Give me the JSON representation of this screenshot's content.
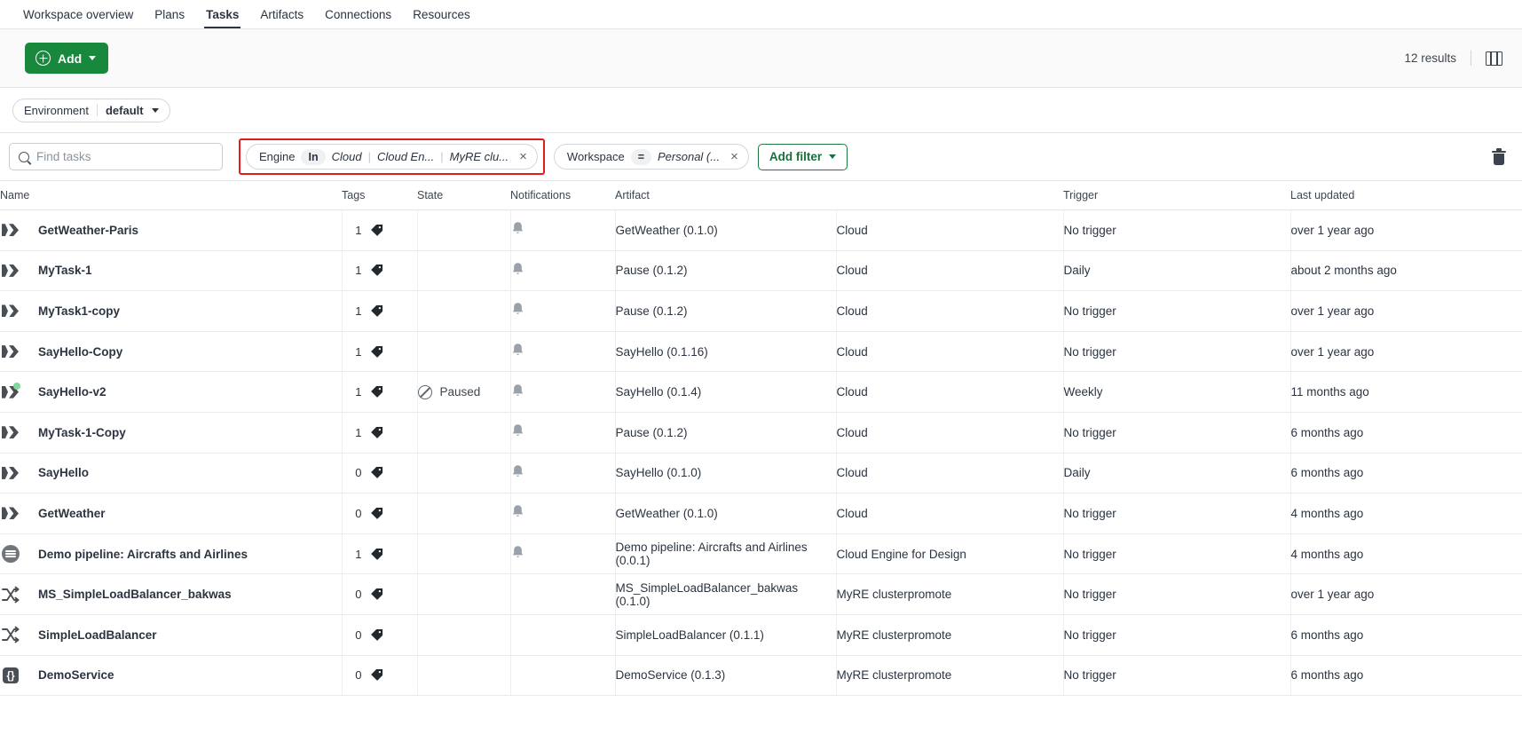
{
  "topnav": {
    "items": [
      {
        "label": "Workspace overview",
        "active": false
      },
      {
        "label": "Plans",
        "active": false
      },
      {
        "label": "Tasks",
        "active": true
      },
      {
        "label": "Artifacts",
        "active": false
      },
      {
        "label": "Connections",
        "active": false
      },
      {
        "label": "Resources",
        "active": false
      }
    ]
  },
  "actionbar": {
    "add_label": "Add",
    "results_label": "12 results",
    "columns_icon": "columns-icon"
  },
  "environment": {
    "label": "Environment",
    "value": "default"
  },
  "search": {
    "placeholder": "Find tasks",
    "value": "",
    "icon": "search-icon"
  },
  "filters": {
    "engine": {
      "key": "Engine",
      "operator": "In",
      "values": [
        "Cloud",
        "Cloud En...",
        "MyRE clu..."
      ],
      "remove_label": "×",
      "highlighted": true
    },
    "workspace": {
      "key": "Workspace",
      "operator": "=",
      "values": [
        "Personal (..."
      ],
      "remove_label": "×"
    },
    "add_filter_label": "Add filter",
    "clear_icon": "trash-icon"
  },
  "table": {
    "columns": [
      "Name",
      "Tags",
      "State",
      "Notifications",
      "Artifact",
      "",
      "Trigger",
      "Last updated"
    ],
    "rows": [
      {
        "icon": "task-icon",
        "badge": false,
        "name": "GetWeather-Paris",
        "tags": "1",
        "state": "",
        "notification": true,
        "artifact": "GetWeather (0.1.0)",
        "engine": "Cloud",
        "trigger": "No trigger",
        "updated": "over 1 year ago"
      },
      {
        "icon": "task-icon",
        "badge": false,
        "name": "MyTask-1",
        "tags": "1",
        "state": "",
        "notification": true,
        "artifact": "Pause (0.1.2)",
        "engine": "Cloud",
        "trigger": "Daily",
        "updated": "about 2 months ago"
      },
      {
        "icon": "task-icon",
        "badge": false,
        "name": "MyTask1-copy",
        "tags": "1",
        "state": "",
        "notification": true,
        "artifact": "Pause (0.1.2)",
        "engine": "Cloud",
        "trigger": "No trigger",
        "updated": "over 1 year ago"
      },
      {
        "icon": "task-icon",
        "badge": false,
        "name": "SayHello-Copy",
        "tags": "1",
        "state": "",
        "notification": true,
        "artifact": "SayHello (0.1.16)",
        "engine": "Cloud",
        "trigger": "No trigger",
        "updated": "over 1 year ago"
      },
      {
        "icon": "task-icon",
        "badge": true,
        "name": "SayHello-v2",
        "tags": "1",
        "state": "Paused",
        "notification": true,
        "artifact": "SayHello (0.1.4)",
        "engine": "Cloud",
        "trigger": "Weekly",
        "updated": "11 months ago"
      },
      {
        "icon": "task-icon",
        "badge": false,
        "name": "MyTask-1-Copy",
        "tags": "1",
        "state": "",
        "notification": true,
        "artifact": "Pause (0.1.2)",
        "engine": "Cloud",
        "trigger": "No trigger",
        "updated": "6 months ago"
      },
      {
        "icon": "task-icon",
        "badge": false,
        "name": "SayHello",
        "tags": "0",
        "state": "",
        "notification": true,
        "artifact": "SayHello (0.1.0)",
        "engine": "Cloud",
        "trigger": "Daily",
        "updated": "6 months ago"
      },
      {
        "icon": "task-icon",
        "badge": false,
        "name": "GetWeather",
        "tags": "0",
        "state": "",
        "notification": true,
        "artifact": "GetWeather (0.1.0)",
        "engine": "Cloud",
        "trigger": "No trigger",
        "updated": "4 months ago"
      },
      {
        "icon": "pipeline-icon",
        "badge": false,
        "name": "Demo pipeline: Aircrafts and Airlines",
        "tags": "1",
        "state": "",
        "notification": true,
        "artifact": "Demo pipeline: Aircrafts and Airlines (0.0.1)",
        "engine": "Cloud Engine for Design",
        "trigger": "No trigger",
        "updated": "4 months ago"
      },
      {
        "icon": "shuffle-icon",
        "badge": false,
        "name": "MS_SimpleLoadBalancer_bakwas",
        "tags": "0",
        "state": "",
        "notification": false,
        "artifact": "MS_SimpleLoadBalancer_bakwas (0.1.0)",
        "engine": "MyRE clusterpromote",
        "trigger": "No trigger",
        "updated": "over 1 year ago"
      },
      {
        "icon": "shuffle-icon",
        "badge": false,
        "name": "SimpleLoadBalancer",
        "tags": "0",
        "state": "",
        "notification": false,
        "artifact": "SimpleLoadBalancer (0.1.1)",
        "engine": "MyRE clusterpromote",
        "trigger": "No trigger",
        "updated": "6 months ago"
      },
      {
        "icon": "service-icon",
        "badge": false,
        "name": "DemoService",
        "tags": "0",
        "state": "",
        "notification": false,
        "artifact": "DemoService (0.1.3)",
        "engine": "MyRE clusterpromote",
        "trigger": "No trigger",
        "updated": "6 months ago"
      }
    ]
  },
  "colors": {
    "brand_green": "#17883c",
    "highlight_red": "#e01c1c",
    "badge_green": "#7fd99a"
  }
}
